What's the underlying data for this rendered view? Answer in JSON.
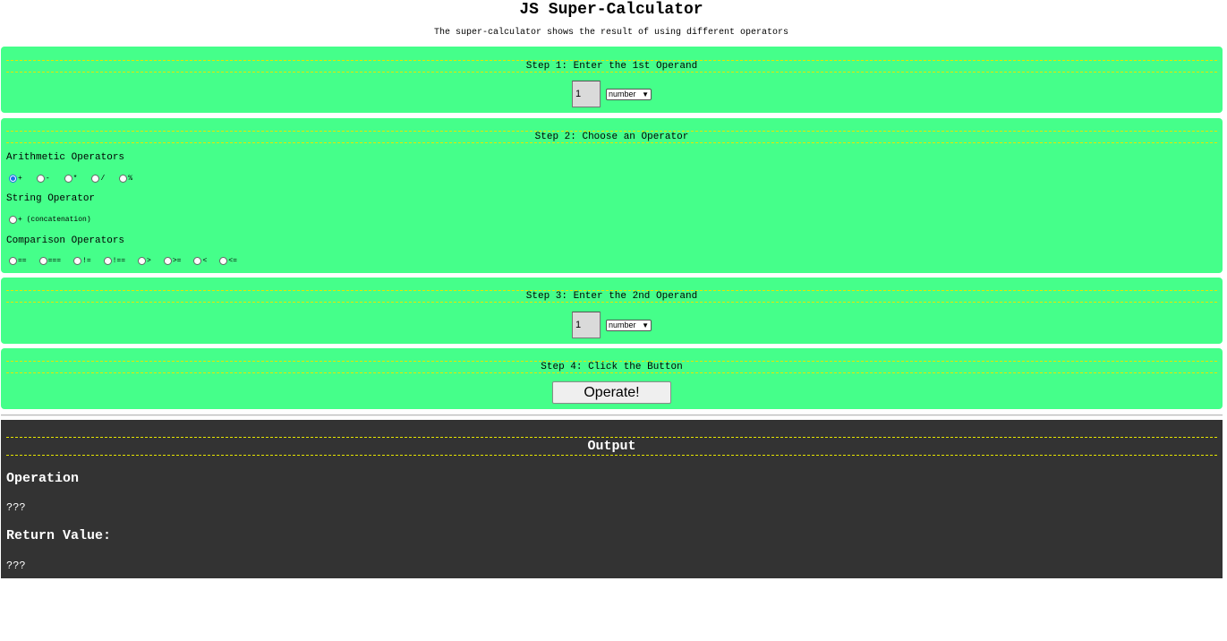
{
  "header": {
    "title": "JS Super-Calculator",
    "subtitle": "The super-calculator shows the result of using different operators"
  },
  "colors": {
    "panel_background": "#45ff8a",
    "heading_rule": "#e6e600",
    "output_background": "#333333",
    "radio_selected": "#1a6fe8"
  },
  "step1": {
    "heading": "Step 1: Enter the 1st Operand",
    "value": "1",
    "type": "number"
  },
  "step2": {
    "heading": "Step 2: Choose an Operator",
    "arithmetic_label": "Arithmetic Operators",
    "arithmetic_ops": [
      {
        "label": "+",
        "checked": true
      },
      {
        "label": "-",
        "checked": false
      },
      {
        "label": "*",
        "checked": false
      },
      {
        "label": "/",
        "checked": false
      },
      {
        "label": "%",
        "checked": false
      }
    ],
    "string_label": "String Operator",
    "string_ops": [
      {
        "label": "+ (concatenation)",
        "checked": false
      }
    ],
    "comparison_label": "Comparison Operators",
    "comparison_ops": [
      {
        "label": "==",
        "checked": false
      },
      {
        "label": "===",
        "checked": false
      },
      {
        "label": "!=",
        "checked": false
      },
      {
        "label": "!==",
        "checked": false
      },
      {
        "label": ">",
        "checked": false
      },
      {
        "label": ">=",
        "checked": false
      },
      {
        "label": "<",
        "checked": false
      },
      {
        "label": "<=",
        "checked": false
      }
    ]
  },
  "step3": {
    "heading": "Step 3: Enter the 2nd Operand",
    "value": "1",
    "type": "number"
  },
  "step4": {
    "heading": "Step 4: Click the Button",
    "button_label": "Operate!"
  },
  "output": {
    "heading": "Output",
    "operation_label": "Operation",
    "operation_value": "???",
    "return_label": "Return Value:",
    "return_value": "???"
  }
}
